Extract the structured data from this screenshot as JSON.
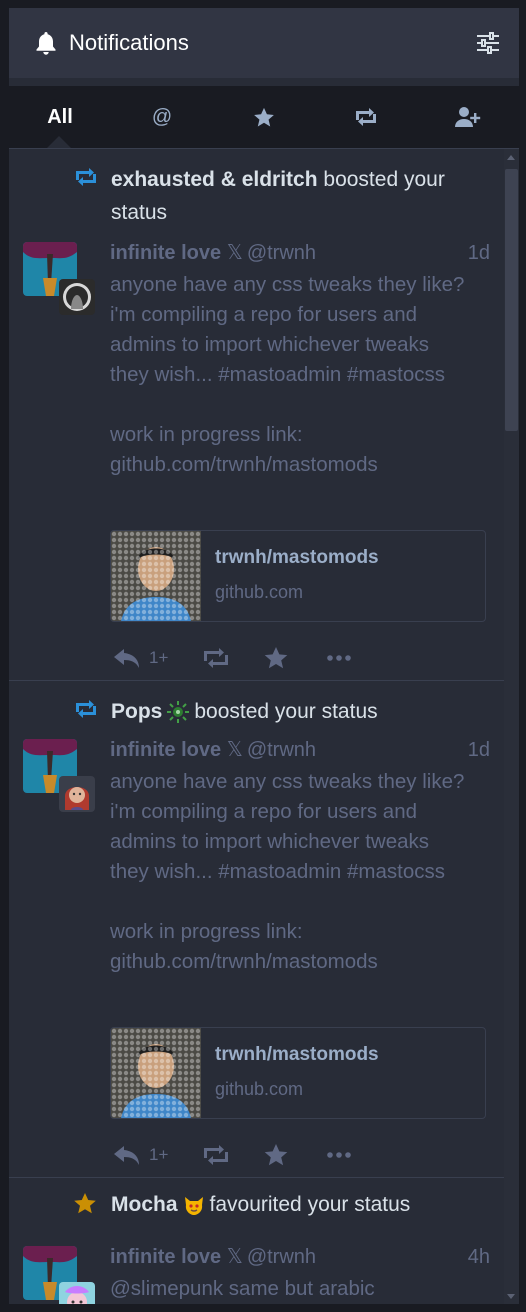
{
  "header": {
    "title": "Notifications",
    "icon": "bell-icon",
    "settings_icon": "sliders-icon"
  },
  "filters": [
    {
      "label": "All",
      "active": true
    },
    {
      "icon": "at-icon",
      "label": "@"
    },
    {
      "icon": "star-icon"
    },
    {
      "icon": "retweet-icon"
    },
    {
      "icon": "user-plus-icon"
    }
  ],
  "notifications": [
    {
      "type": "reblog",
      "actor": "exhausted & eldritch",
      "action_line1": " boosted your",
      "action_line2": "status",
      "status": {
        "display_name": "infinite love",
        "name_glyph": "𝕏",
        "handle": "@trwnh",
        "time": "1d",
        "body": "anyone have any css tweaks they like? i'm compiling a repo for users and admins to import whichever tweaks they wish... #mastoadmin #mastocss\n\nwork in progress link: github.com/trwnh/mastomods",
        "card": {
          "title": "trwnh/mastomods",
          "provider": "github.com"
        },
        "reply_count": "1+"
      }
    },
    {
      "type": "reblog",
      "actor": "Pops",
      "action": "boosted your status",
      "status": {
        "display_name": "infinite love",
        "name_glyph": "𝕏",
        "handle": "@trwnh",
        "time": "1d",
        "body": "anyone have any css tweaks they like? i'm compiling a repo for users and admins to import whichever tweaks they wish... #mastoadmin #mastocss\n\nwork in progress link: github.com/trwnh/mastomods",
        "card": {
          "title": "trwnh/mastomods",
          "provider": "github.com"
        },
        "reply_count": "1+"
      }
    },
    {
      "type": "favourite",
      "actor": "Mocha",
      "action": "favourited your status",
      "status": {
        "display_name": "infinite love",
        "name_glyph": "𝕏",
        "handle": "@trwnh",
        "time": "4h",
        "body": "@slimepunk same but arabic"
      }
    }
  ],
  "colors": {
    "column_bg": "#282c37",
    "header_bg": "#313543",
    "muted_text": "#606984",
    "boost_blue": "#2b90d9",
    "fav_gold": "#ca8f04"
  }
}
